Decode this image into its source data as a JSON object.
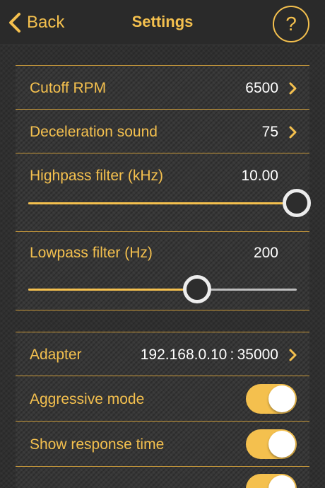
{
  "nav": {
    "back_label": "Back",
    "title": "Settings",
    "help_label": "?"
  },
  "engine": {
    "cutoff_rpm": {
      "label": "Cutoff RPM",
      "value": "6500"
    },
    "decel_sound": {
      "label": "Deceleration sound",
      "value": "75"
    },
    "highpass": {
      "label": "Highpass filter (kHz)",
      "value": "10.00",
      "fraction": 1.0
    },
    "lowpass": {
      "label": "Lowpass filter (Hz)",
      "value": "200",
      "fraction": 0.63
    }
  },
  "connection": {
    "adapter": {
      "label": "Adapter",
      "value": "192.168.0.10 : 35000"
    },
    "aggressive": {
      "label": "Aggressive mode",
      "on": true
    },
    "response_time": {
      "label": "Show response time",
      "on": true
    }
  },
  "colors": {
    "accent": "#f4c04e",
    "background": "#2f2f2f",
    "value_text": "#ffffff"
  }
}
